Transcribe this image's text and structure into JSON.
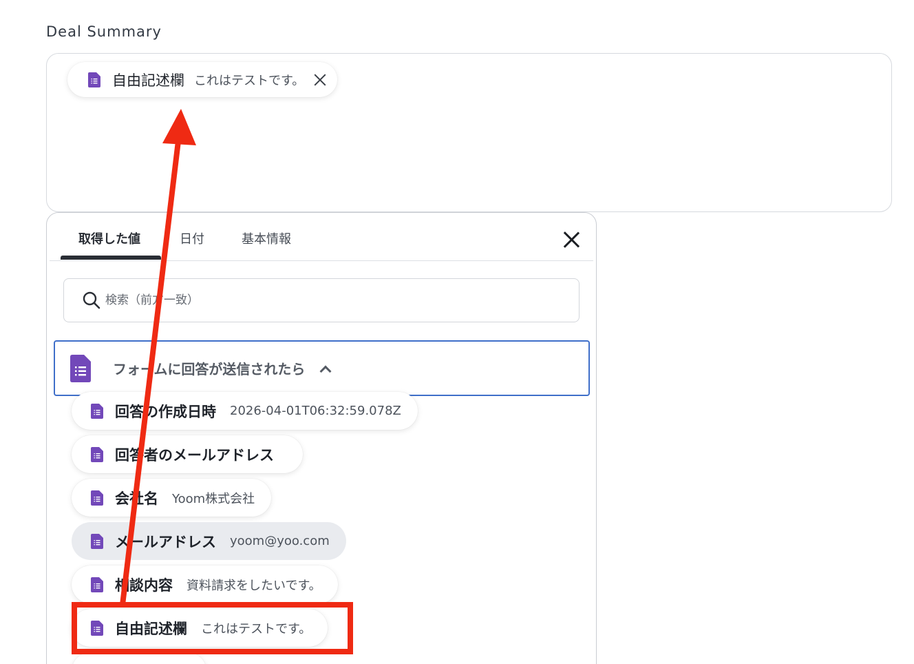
{
  "field": {
    "label": "Deal Summary"
  },
  "summary_chip": {
    "title": "自由記述欄",
    "value": "これはテストです。",
    "icon": "google-forms-doc-icon"
  },
  "panel": {
    "tabs": [
      {
        "label": "取得した値",
        "active": true
      },
      {
        "label": "日付",
        "active": false
      },
      {
        "label": "基本情報",
        "active": false
      }
    ],
    "search": {
      "placeholder": "検索（前方一致）"
    },
    "group": {
      "title": "フォームに回答が送信されたら",
      "expanded": true
    },
    "items": [
      {
        "title": "回答の作成日時",
        "value": "2026-04-01T06:32:59.078Z"
      },
      {
        "title": "回答者のメールアドレス",
        "value": ""
      },
      {
        "title": "会社名",
        "value": "Yoom株式会社"
      },
      {
        "title": "メールアドレス",
        "value": "yoom@yoo.com"
      },
      {
        "title": "相談内容",
        "value": "資料請求をしたいです。"
      },
      {
        "title": "自由記述欄",
        "value": "これはテストです。"
      }
    ]
  },
  "colors": {
    "annotation": "#ef2a13",
    "focus_border": "#3f6fc9",
    "forms_purple": "#7248b9"
  }
}
